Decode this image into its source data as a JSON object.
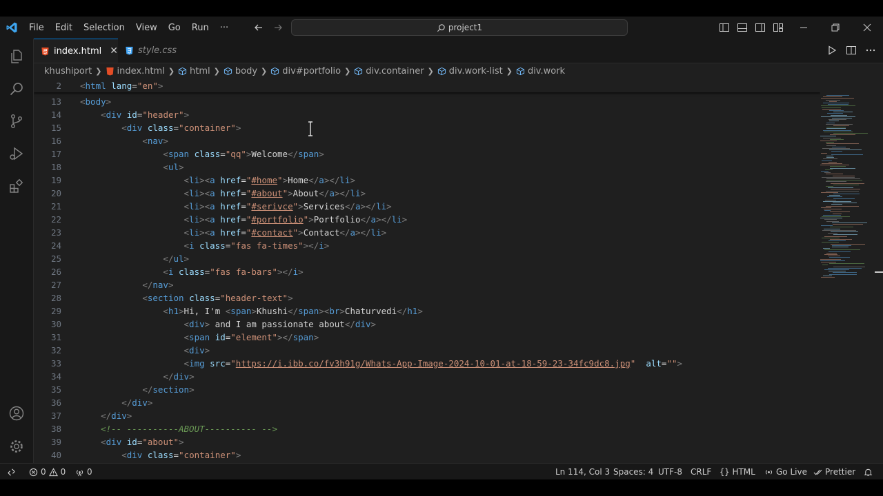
{
  "menu": [
    "File",
    "Edit",
    "Selection",
    "View",
    "Go",
    "Run",
    "···"
  ],
  "search": {
    "text": "project1"
  },
  "tabs": [
    {
      "label": "index.html",
      "active": true
    },
    {
      "label": "style.css",
      "active": false
    }
  ],
  "breadcrumb": {
    "folder": "khushiport",
    "file": "index.html",
    "items": [
      "html",
      "body",
      "div#portfolio",
      "div.container",
      "div.work-list",
      "div.work"
    ]
  },
  "code_lines": [
    {
      "n": "2",
      "sticky": true,
      "tokens": [
        [
          "t-br",
          "<"
        ],
        [
          "t-tag",
          "html"
        ],
        [
          "t-text",
          " "
        ],
        [
          "t-attr",
          "lang"
        ],
        [
          "t-text",
          "="
        ],
        [
          "t-str",
          "\"en\""
        ],
        [
          "t-br",
          ">"
        ]
      ]
    },
    {
      "n": "13",
      "tokens": [
        [
          "t-br",
          "<"
        ],
        [
          "t-tag",
          "body"
        ],
        [
          "t-br",
          ">"
        ]
      ]
    },
    {
      "n": "14",
      "tokens": [
        [
          "t-text",
          "    "
        ],
        [
          "t-br",
          "<"
        ],
        [
          "t-tag",
          "div"
        ],
        [
          "t-text",
          " "
        ],
        [
          "t-attr",
          "id"
        ],
        [
          "t-text",
          "="
        ],
        [
          "t-str",
          "\"header\""
        ],
        [
          "t-br",
          ">"
        ]
      ]
    },
    {
      "n": "15",
      "tokens": [
        [
          "t-text",
          "        "
        ],
        [
          "t-br",
          "<"
        ],
        [
          "t-tag",
          "div"
        ],
        [
          "t-text",
          " "
        ],
        [
          "t-attr",
          "class"
        ],
        [
          "t-text",
          "="
        ],
        [
          "t-str",
          "\"container\""
        ],
        [
          "t-br",
          ">"
        ]
      ]
    },
    {
      "n": "16",
      "tokens": [
        [
          "t-text",
          "            "
        ],
        [
          "t-br",
          "<"
        ],
        [
          "t-tag",
          "nav"
        ],
        [
          "t-br",
          ">"
        ]
      ]
    },
    {
      "n": "17",
      "tokens": [
        [
          "t-text",
          "                "
        ],
        [
          "t-br",
          "<"
        ],
        [
          "t-tag",
          "span"
        ],
        [
          "t-text",
          " "
        ],
        [
          "t-attr",
          "class"
        ],
        [
          "t-text",
          "="
        ],
        [
          "t-str",
          "\"qq\""
        ],
        [
          "t-br",
          ">"
        ],
        [
          "t-text",
          "Welcome"
        ],
        [
          "t-br",
          "</"
        ],
        [
          "t-tag",
          "span"
        ],
        [
          "t-br",
          ">"
        ]
      ]
    },
    {
      "n": "18",
      "tokens": [
        [
          "t-text",
          "                "
        ],
        [
          "t-br",
          "<"
        ],
        [
          "t-tag",
          "ul"
        ],
        [
          "t-br",
          ">"
        ]
      ]
    },
    {
      "n": "19",
      "tokens": [
        [
          "t-text",
          "                    "
        ],
        [
          "t-br",
          "<"
        ],
        [
          "t-tag",
          "li"
        ],
        [
          "t-br",
          "><"
        ],
        [
          "t-tag",
          "a"
        ],
        [
          "t-text",
          " "
        ],
        [
          "t-attr",
          "href"
        ],
        [
          "t-text",
          "="
        ],
        [
          "t-str",
          "\""
        ],
        [
          "t-link",
          "#home"
        ],
        [
          "t-str",
          "\""
        ],
        [
          "t-br",
          ">"
        ],
        [
          "t-text",
          "Home"
        ],
        [
          "t-br",
          "</"
        ],
        [
          "t-tag",
          "a"
        ],
        [
          "t-br",
          "></"
        ],
        [
          "t-tag",
          "li"
        ],
        [
          "t-br",
          ">"
        ]
      ]
    },
    {
      "n": "20",
      "tokens": [
        [
          "t-text",
          "                    "
        ],
        [
          "t-br",
          "<"
        ],
        [
          "t-tag",
          "li"
        ],
        [
          "t-br",
          "><"
        ],
        [
          "t-tag",
          "a"
        ],
        [
          "t-text",
          " "
        ],
        [
          "t-attr",
          "href"
        ],
        [
          "t-text",
          "="
        ],
        [
          "t-str",
          "\""
        ],
        [
          "t-link",
          "#about"
        ],
        [
          "t-str",
          "\""
        ],
        [
          "t-br",
          ">"
        ],
        [
          "t-text",
          "About"
        ],
        [
          "t-br",
          "</"
        ],
        [
          "t-tag",
          "a"
        ],
        [
          "t-br",
          "></"
        ],
        [
          "t-tag",
          "li"
        ],
        [
          "t-br",
          ">"
        ]
      ]
    },
    {
      "n": "21",
      "tokens": [
        [
          "t-text",
          "                    "
        ],
        [
          "t-br",
          "<"
        ],
        [
          "t-tag",
          "li"
        ],
        [
          "t-br",
          "><"
        ],
        [
          "t-tag",
          "a"
        ],
        [
          "t-text",
          " "
        ],
        [
          "t-attr",
          "href"
        ],
        [
          "t-text",
          "="
        ],
        [
          "t-str",
          "\""
        ],
        [
          "t-link",
          "#serivce"
        ],
        [
          "t-str",
          "\""
        ],
        [
          "t-br",
          ">"
        ],
        [
          "t-text",
          "Services"
        ],
        [
          "t-br",
          "</"
        ],
        [
          "t-tag",
          "a"
        ],
        [
          "t-br",
          "></"
        ],
        [
          "t-tag",
          "li"
        ],
        [
          "t-br",
          ">"
        ]
      ]
    },
    {
      "n": "22",
      "tokens": [
        [
          "t-text",
          "                    "
        ],
        [
          "t-br",
          "<"
        ],
        [
          "t-tag",
          "li"
        ],
        [
          "t-br",
          "><"
        ],
        [
          "t-tag",
          "a"
        ],
        [
          "t-text",
          " "
        ],
        [
          "t-attr",
          "href"
        ],
        [
          "t-text",
          "="
        ],
        [
          "t-str",
          "\""
        ],
        [
          "t-link",
          "#portfolio"
        ],
        [
          "t-str",
          "\""
        ],
        [
          "t-br",
          ">"
        ],
        [
          "t-text",
          "Portfolio"
        ],
        [
          "t-br",
          "</"
        ],
        [
          "t-tag",
          "a"
        ],
        [
          "t-br",
          "></"
        ],
        [
          "t-tag",
          "li"
        ],
        [
          "t-br",
          ">"
        ]
      ]
    },
    {
      "n": "23",
      "tokens": [
        [
          "t-text",
          "                    "
        ],
        [
          "t-br",
          "<"
        ],
        [
          "t-tag",
          "li"
        ],
        [
          "t-br",
          "><"
        ],
        [
          "t-tag",
          "a"
        ],
        [
          "t-text",
          " "
        ],
        [
          "t-attr",
          "href"
        ],
        [
          "t-text",
          "="
        ],
        [
          "t-str",
          "\""
        ],
        [
          "t-link",
          "#contact"
        ],
        [
          "t-str",
          "\""
        ],
        [
          "t-br",
          ">"
        ],
        [
          "t-text",
          "Contact"
        ],
        [
          "t-br",
          "</"
        ],
        [
          "t-tag",
          "a"
        ],
        [
          "t-br",
          "></"
        ],
        [
          "t-tag",
          "li"
        ],
        [
          "t-br",
          ">"
        ]
      ]
    },
    {
      "n": "24",
      "tokens": [
        [
          "t-text",
          "                    "
        ],
        [
          "t-br",
          "<"
        ],
        [
          "t-tag",
          "i"
        ],
        [
          "t-text",
          " "
        ],
        [
          "t-attr",
          "class"
        ],
        [
          "t-text",
          "="
        ],
        [
          "t-str",
          "\"fas fa-times\""
        ],
        [
          "t-br",
          "></"
        ],
        [
          "t-tag",
          "i"
        ],
        [
          "t-br",
          ">"
        ]
      ]
    },
    {
      "n": "25",
      "tokens": [
        [
          "t-text",
          "                "
        ],
        [
          "t-br",
          "</"
        ],
        [
          "t-tag",
          "ul"
        ],
        [
          "t-br",
          ">"
        ]
      ]
    },
    {
      "n": "26",
      "tokens": [
        [
          "t-text",
          "                "
        ],
        [
          "t-br",
          "<"
        ],
        [
          "t-tag",
          "i"
        ],
        [
          "t-text",
          " "
        ],
        [
          "t-attr",
          "class"
        ],
        [
          "t-text",
          "="
        ],
        [
          "t-str",
          "\"fas fa-bars\""
        ],
        [
          "t-br",
          "></"
        ],
        [
          "t-tag",
          "i"
        ],
        [
          "t-br",
          ">"
        ]
      ]
    },
    {
      "n": "27",
      "tokens": [
        [
          "t-text",
          "            "
        ],
        [
          "t-br",
          "</"
        ],
        [
          "t-tag",
          "nav"
        ],
        [
          "t-br",
          ">"
        ]
      ]
    },
    {
      "n": "28",
      "tokens": [
        [
          "t-text",
          "            "
        ],
        [
          "t-br",
          "<"
        ],
        [
          "t-tag",
          "section"
        ],
        [
          "t-text",
          " "
        ],
        [
          "t-attr",
          "class"
        ],
        [
          "t-text",
          "="
        ],
        [
          "t-str",
          "\"header-text\""
        ],
        [
          "t-br",
          ">"
        ]
      ]
    },
    {
      "n": "29",
      "tokens": [
        [
          "t-text",
          "                "
        ],
        [
          "t-br",
          "<"
        ],
        [
          "t-tag",
          "h1"
        ],
        [
          "t-br",
          ">"
        ],
        [
          "t-text",
          "Hi, I'm "
        ],
        [
          "t-br",
          "<"
        ],
        [
          "t-tag",
          "span"
        ],
        [
          "t-br",
          ">"
        ],
        [
          "t-text",
          "Khushi"
        ],
        [
          "t-br",
          "</"
        ],
        [
          "t-tag",
          "span"
        ],
        [
          "t-br",
          "><"
        ],
        [
          "t-tag",
          "br"
        ],
        [
          "t-br",
          ">"
        ],
        [
          "t-text",
          "Chaturvedi"
        ],
        [
          "t-br",
          "</"
        ],
        [
          "t-tag",
          "h1"
        ],
        [
          "t-br",
          ">"
        ]
      ]
    },
    {
      "n": "30",
      "tokens": [
        [
          "t-text",
          "                    "
        ],
        [
          "t-br",
          "<"
        ],
        [
          "t-tag",
          "div"
        ],
        [
          "t-br",
          ">"
        ],
        [
          "t-text",
          " and I am passionate about"
        ],
        [
          "t-br",
          "</"
        ],
        [
          "t-tag",
          "div"
        ],
        [
          "t-br",
          ">"
        ]
      ]
    },
    {
      "n": "31",
      "tokens": [
        [
          "t-text",
          "                    "
        ],
        [
          "t-br",
          "<"
        ],
        [
          "t-tag",
          "span"
        ],
        [
          "t-text",
          " "
        ],
        [
          "t-attr",
          "id"
        ],
        [
          "t-text",
          "="
        ],
        [
          "t-str",
          "\"element\""
        ],
        [
          "t-br",
          "></"
        ],
        [
          "t-tag",
          "span"
        ],
        [
          "t-br",
          ">"
        ]
      ]
    },
    {
      "n": "32",
      "tokens": [
        [
          "t-text",
          "                    "
        ],
        [
          "t-br",
          "<"
        ],
        [
          "t-tag",
          "div"
        ],
        [
          "t-br",
          ">"
        ]
      ]
    },
    {
      "n": "33",
      "tokens": [
        [
          "t-text",
          "                    "
        ],
        [
          "t-br",
          "<"
        ],
        [
          "t-tag",
          "img"
        ],
        [
          "t-text",
          " "
        ],
        [
          "t-attr",
          "src"
        ],
        [
          "t-text",
          "="
        ],
        [
          "t-str",
          "\""
        ],
        [
          "t-link",
          "https://i.ibb.co/fv3h91g/Whats-App-Image-2024-10-01-at-18-59-23-34fc9dc8.jpg"
        ],
        [
          "t-str",
          "\""
        ],
        [
          "t-text",
          "  "
        ],
        [
          "t-attr",
          "alt"
        ],
        [
          "t-text",
          "="
        ],
        [
          "t-str",
          "\"\""
        ],
        [
          "t-br",
          ">"
        ]
      ]
    },
    {
      "n": "34",
      "tokens": [
        [
          "t-text",
          "                "
        ],
        [
          "t-br",
          "</"
        ],
        [
          "t-tag",
          "div"
        ],
        [
          "t-br",
          ">"
        ]
      ]
    },
    {
      "n": "35",
      "tokens": [
        [
          "t-text",
          "            "
        ],
        [
          "t-br",
          "</"
        ],
        [
          "t-tag",
          "section"
        ],
        [
          "t-br",
          ">"
        ]
      ]
    },
    {
      "n": "36",
      "tokens": [
        [
          "t-text",
          "        "
        ],
        [
          "t-br",
          "</"
        ],
        [
          "t-tag",
          "div"
        ],
        [
          "t-br",
          ">"
        ]
      ]
    },
    {
      "n": "37",
      "tokens": [
        [
          "t-text",
          "    "
        ],
        [
          "t-br",
          "</"
        ],
        [
          "t-tag",
          "div"
        ],
        [
          "t-br",
          ">"
        ]
      ]
    },
    {
      "n": "38",
      "tokens": [
        [
          "t-text",
          "    "
        ],
        [
          "t-com",
          "<!-- ----------ABOUT---------- -->"
        ]
      ]
    },
    {
      "n": "39",
      "tokens": [
        [
          "t-text",
          "    "
        ],
        [
          "t-br",
          "<"
        ],
        [
          "t-tag",
          "div"
        ],
        [
          "t-text",
          " "
        ],
        [
          "t-attr",
          "id"
        ],
        [
          "t-text",
          "="
        ],
        [
          "t-str",
          "\"about\""
        ],
        [
          "t-br",
          ">"
        ]
      ]
    },
    {
      "n": "40",
      "tokens": [
        [
          "t-text",
          "        "
        ],
        [
          "t-br",
          "<"
        ],
        [
          "t-tag",
          "div"
        ],
        [
          "t-text",
          " "
        ],
        [
          "t-attr",
          "class"
        ],
        [
          "t-text",
          "="
        ],
        [
          "t-str",
          "\"container\""
        ],
        [
          "t-br",
          ">"
        ]
      ]
    }
  ],
  "status": {
    "errors": "0",
    "warnings": "0",
    "ports": "0",
    "position": "Ln 114, Col 3",
    "spaces": "Spaces: 4",
    "encoding": "UTF-8",
    "eol": "CRLF",
    "language": "HTML",
    "golive": "Go Live",
    "prettier": "Prettier"
  },
  "colors": {
    "accent": "#0078d4",
    "tag": "#569cd6",
    "attr": "#9cdcfe",
    "string": "#ce9178",
    "comment": "#6a9955"
  }
}
